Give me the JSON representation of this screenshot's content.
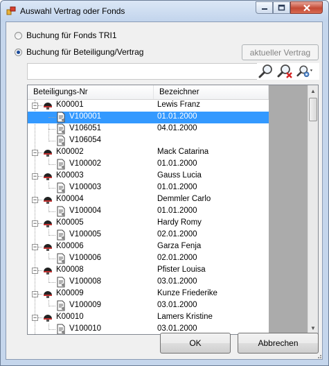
{
  "window": {
    "title": "Auswahl Vertrag oder Fonds",
    "controls": [
      "minimize",
      "maximize",
      "close"
    ]
  },
  "options": {
    "fonds_label": "Buchung für Fonds TRI1",
    "vertrag_label": "Buchung für Beteiligung/Vertrag",
    "selected": "vertrag"
  },
  "current_contract_button": "aktueller Vertrag",
  "search": {
    "value": "",
    "placeholder": ""
  },
  "toolbar_icons": [
    "search-icon",
    "clear-search-icon",
    "search-options-icon"
  ],
  "table": {
    "columns": [
      "Beteiligungs-Nr",
      "Bezeichner"
    ],
    "rows": [
      {
        "level": 0,
        "id": "K00001",
        "name": "Lewis Franz"
      },
      {
        "level": 1,
        "id": "V100001",
        "name": "01.01.2000",
        "selected": true
      },
      {
        "level": 1,
        "id": "V106051",
        "name": "04.01.2000"
      },
      {
        "level": 1,
        "id": "V106054",
        "name": ""
      },
      {
        "level": 0,
        "id": "K00002",
        "name": "Mack Catarina"
      },
      {
        "level": 1,
        "id": "V100002",
        "name": "01.01.2000"
      },
      {
        "level": 0,
        "id": "K00003",
        "name": "Gauss Lucia"
      },
      {
        "level": 1,
        "id": "V100003",
        "name": "01.01.2000"
      },
      {
        "level": 0,
        "id": "K00004",
        "name": "Demmler Carlo"
      },
      {
        "level": 1,
        "id": "V100004",
        "name": "01.01.2000"
      },
      {
        "level": 0,
        "id": "K00005",
        "name": "Hardy Romy"
      },
      {
        "level": 1,
        "id": "V100005",
        "name": "02.01.2000"
      },
      {
        "level": 0,
        "id": "K00006",
        "name": "Garza Fenja"
      },
      {
        "level": 1,
        "id": "V100006",
        "name": "02.01.2000"
      },
      {
        "level": 0,
        "id": "K00008",
        "name": "Pfister Louisa"
      },
      {
        "level": 1,
        "id": "V100008",
        "name": "03.01.2000"
      },
      {
        "level": 0,
        "id": "K00009",
        "name": "Kunze Friederike"
      },
      {
        "level": 1,
        "id": "V100009",
        "name": "03.01.2000"
      },
      {
        "level": 0,
        "id": "K00010",
        "name": "Lamers Kristine"
      },
      {
        "level": 1,
        "id": "V100010",
        "name": "03.01.2000"
      }
    ]
  },
  "buttons": {
    "ok": "OK",
    "cancel": "Abbrechen"
  },
  "colors": {
    "selection": "#3399ff",
    "panel_grey": "#ababab",
    "title_bg": "#c5d6ec"
  }
}
